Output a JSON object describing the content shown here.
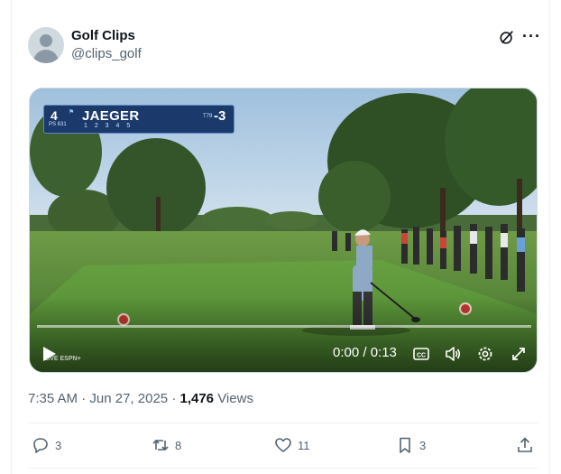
{
  "author": {
    "name": "Golf Clips",
    "handle": "@clips_golf"
  },
  "header_icons": [
    "grok-icon",
    "more-icon"
  ],
  "video": {
    "scorebug": {
      "hole": "4",
      "par_yds": "PS 631",
      "player": "JAEGER",
      "holes_row": "1 2 3 4 5",
      "thru": "T79",
      "score": "-3"
    },
    "broadcast_logo": "LIVE ESPN+",
    "time": "0:00 / 0:13",
    "progress": 0.0
  },
  "post_meta": {
    "time": "7:35 AM",
    "date": "Jun 27, 2025",
    "views_count": "1,476",
    "views_label": "Views"
  },
  "actions": {
    "replies": "3",
    "reposts": "8",
    "likes": "11",
    "bookmarks": "3"
  }
}
